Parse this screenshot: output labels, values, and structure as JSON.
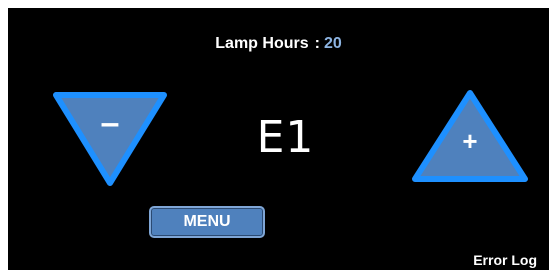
{
  "lamp_hours": {
    "label": "Lamp Hours",
    "separator": ":",
    "value": "20"
  },
  "decrement_button": {
    "label": "–"
  },
  "increment_button": {
    "label": "+"
  },
  "code_display": {
    "value": "E1"
  },
  "menu_button": {
    "label": "MENU"
  },
  "error_log_link": {
    "label": "Error Log"
  },
  "colors": {
    "background": "#000000",
    "accent": "#4f81bd",
    "accent_border": "#1e90ff",
    "value_text": "#8db4e2"
  }
}
